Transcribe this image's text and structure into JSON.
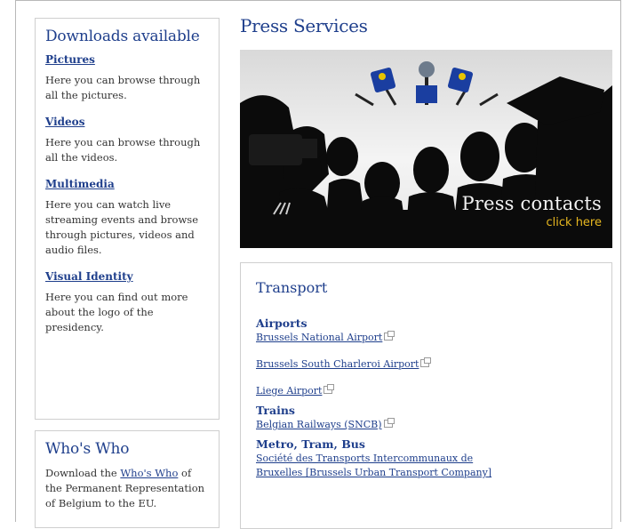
{
  "downloads": {
    "title": "Downloads available",
    "items": [
      {
        "label": "Pictures",
        "text": "Here you can browse through all the pictures."
      },
      {
        "label": "Videos",
        "text": "Here you can browse through all the videos."
      },
      {
        "label": "Multimedia",
        "text": "Here you can watch live streaming events and browse through pictures, videos and audio files."
      },
      {
        "label": "Visual Identity",
        "text": "Here you can find out more about the logo of the presidency."
      }
    ]
  },
  "whos_who": {
    "title": "Who's Who",
    "text_before": "Download the ",
    "link": "Who's Who",
    "text_after": " of the Permanent Representation of Belgium to the EU."
  },
  "press": {
    "title": "Press Services",
    "banner_title": "Press contacts",
    "banner_cta": "click here"
  },
  "transport": {
    "title": "Transport",
    "airports_heading": "Airports",
    "airports": [
      "Brussels National Airport",
      "Brussels South Charleroi Airport",
      "Liege Airport"
    ],
    "trains_heading": "Trains",
    "trains": [
      "Belgian Railways (SNCB)"
    ],
    "metro_heading": "Metro, Tram, Bus",
    "metro": [
      "Société des Transports Intercommunaux de",
      "Bruxelles [Brussels Urban Transport Company]"
    ]
  },
  "colors": {
    "link": "#1f3f8c",
    "cta": "#e8b820"
  }
}
